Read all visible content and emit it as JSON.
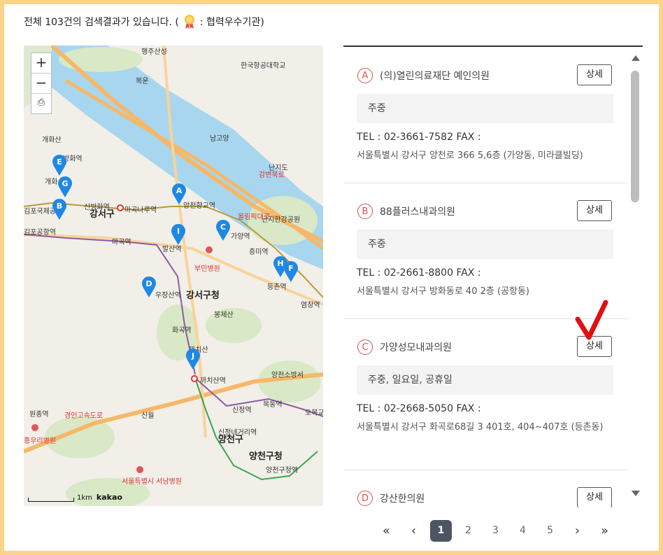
{
  "summary": {
    "text_before": "전체 103건의 검색결과가 있습니다. (",
    "text_after": ": 협력우수기관)",
    "medal_icon": "award-medal-icon"
  },
  "map": {
    "zoom_in": "+",
    "zoom_out": "−",
    "print_icon": "printer-icon",
    "labels": [
      "행주산성",
      "개화산",
      "방화역",
      "개화",
      "신방화역",
      "마곡나루역",
      "강서구",
      "김포국제공항",
      "김포공항역",
      "마곡역",
      "발산역",
      "우장산역",
      "강서구청",
      "부민병원",
      "화곡역",
      "봉제산",
      "까치산",
      "까치산역",
      "양천구",
      "양천구청",
      "신정역",
      "목동역",
      "오목교",
      "원종역",
      "신월",
      "양천소방서",
      "서울특별시 서남병원",
      "한국항공대학교",
      "난지도",
      "난지한강공원",
      "양천향교역",
      "가양역",
      "증미역",
      "등촌역",
      "염창역",
      "신정네거리역",
      "양천구청역",
      "경인고속도로",
      "올림픽대로",
      "강변북로",
      "남고양",
      "복운",
      "흥우리병원"
    ],
    "markers": [
      "A",
      "B",
      "C",
      "D",
      "E",
      "F",
      "G",
      "H",
      "I",
      "J"
    ],
    "scale": "1km",
    "brand": "kakao"
  },
  "list": {
    "detail_label": "상세",
    "items": [
      {
        "letter": "A",
        "name": "(의)열린의료재단 예인의원",
        "hours": "주중",
        "tel": "TEL : 02-3661-7582   FAX :",
        "address": "서울특별시 강서구 양천로 366 5,6층 (가양동, 미라클빌딩)"
      },
      {
        "letter": "B",
        "name": "88플러스내과의원",
        "hours": "주중",
        "tel": "TEL : 02-2661-8800   FAX :",
        "address": "서울특별시 강서구 방화동로 40 2층 (공항동)"
      },
      {
        "letter": "C",
        "name": "가양성모내과의원",
        "hours": "주중, 일요일, 공휴일",
        "tel": "TEL : 02-2668-5050   FAX :",
        "address": "서울특별시 강서구 화곡로68길 3 401호, 404~407호 (등촌동)"
      },
      {
        "letter": "D",
        "name": "강산한의원"
      }
    ]
  },
  "pagination": {
    "first": "«",
    "prev": "‹",
    "pages": [
      "1",
      "2",
      "3",
      "4",
      "5"
    ],
    "current": "1",
    "next": "›",
    "last": "»"
  },
  "colors": {
    "frame": "#ffd387",
    "marker": "#1e88e5",
    "letter": "#d9534f",
    "check": "#e01010"
  }
}
